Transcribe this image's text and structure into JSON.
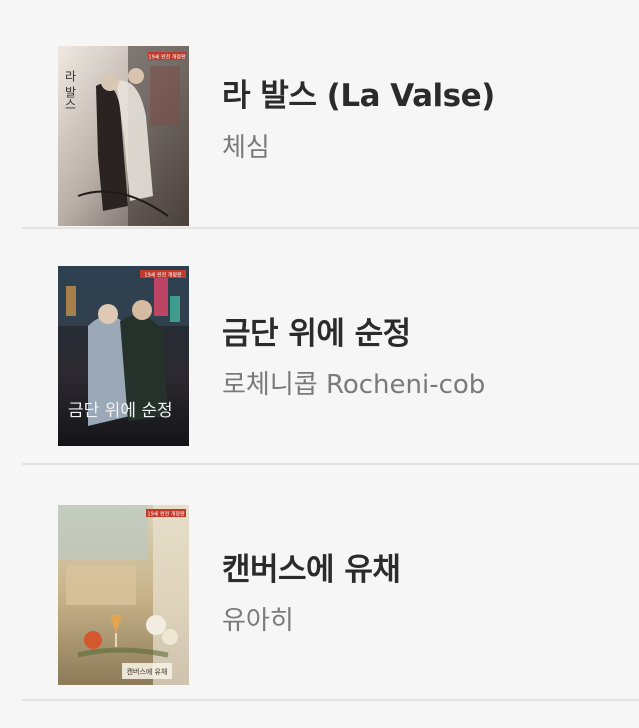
{
  "books": [
    {
      "title": "라 발스 (La Valse)",
      "author": "체심",
      "cover_text": "라 발스",
      "cover_badge": "19세 완전 개정판"
    },
    {
      "title": "금단 위에 순정",
      "author": "로체니콥 Rocheni-cob",
      "cover_text": "금단 위에 순정",
      "cover_badge": "19세 완전 개정판"
    },
    {
      "title": "캔버스에 유채",
      "author": "유아히",
      "cover_text": "캔버스에 유채",
      "cover_badge": "19세 완전 개정판"
    }
  ],
  "colors": {
    "background": "#f6f6f6",
    "title": "#2b2b2b",
    "author": "#7a7a7a",
    "divider": "#e3e3e3",
    "badge": "#c0392b"
  }
}
